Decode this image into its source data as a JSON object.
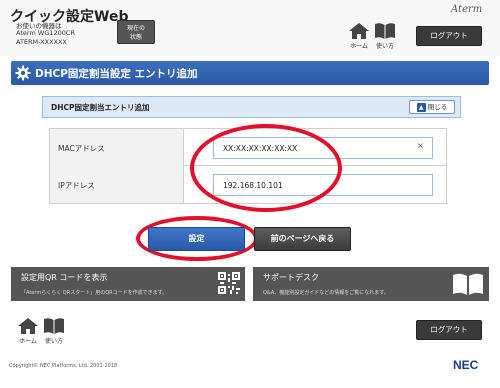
{
  "header": {
    "app_title": "クイック設定Web",
    "device_lines": [
      "お使いの機器は",
      "Aterm WG1200CR",
      "ATERM-XXXXXX"
    ],
    "state_button_lines": [
      "現在の",
      "状態"
    ],
    "logo": "Aterm",
    "home_label": "ホーム",
    "howto_label": "使い方",
    "logout_label": "ログアウト"
  },
  "page": {
    "title": "DHCP固定割当設定 エントリ追加"
  },
  "section": {
    "title": "DHCP固定割当エントリ追加",
    "close_label": "閉じる",
    "close_icon": "chevron-up-icon"
  },
  "form": {
    "mac": {
      "label": "MACアドレス",
      "value": "XX:XX:XX:XX:XX:XX",
      "clear_icon": "×"
    },
    "ip": {
      "label": "IPアドレス",
      "value": "192.168.10.101"
    }
  },
  "actions": {
    "set_label": "設定",
    "back_label": "前のページへ戻る"
  },
  "panels": {
    "qr": {
      "title": "設定用QR コードを表示",
      "desc": "「Atermらくらく QRスタート」用のQRコードを作成できます。",
      "icon": "qr-code-icon"
    },
    "support": {
      "title": "サポートデスク",
      "desc": "Q&A、機能別設定ガイドなどの情報をご覧になれます。",
      "icon": "book-icon"
    }
  },
  "footer": {
    "home_label": "ホーム",
    "howto_label": "使い方",
    "logout_label": "ログアウト",
    "copyright": "Copyright© NEC Platforms, Ltd. 2001-2018",
    "logo": "NEC"
  },
  "colors": {
    "accent_blue": "#2a58a6",
    "dark_button": "#3a3a3a",
    "highlight_red": "#e3102b"
  }
}
